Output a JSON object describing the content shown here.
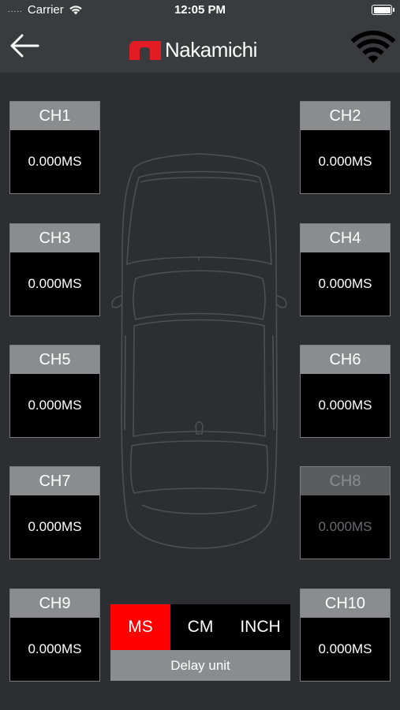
{
  "status_bar": {
    "signal_dots": ".....",
    "carrier": "Carrier",
    "time": "12:05 PM"
  },
  "header": {
    "brand": "Nakamichi",
    "back_icon": "back-arrow-icon",
    "wifi_icon": "wifi-icon"
  },
  "channels": [
    {
      "name": "CH1",
      "value": "0.000MS",
      "enabled": true
    },
    {
      "name": "CH2",
      "value": "0.000MS",
      "enabled": true
    },
    {
      "name": "CH3",
      "value": "0.000MS",
      "enabled": true
    },
    {
      "name": "CH4",
      "value": "0.000MS",
      "enabled": true
    },
    {
      "name": "CH5",
      "value": "0.000MS",
      "enabled": true
    },
    {
      "name": "CH6",
      "value": "0.000MS",
      "enabled": true
    },
    {
      "name": "CH7",
      "value": "0.000MS",
      "enabled": true
    },
    {
      "name": "CH8",
      "value": "0.000MS",
      "enabled": false
    },
    {
      "name": "CH9",
      "value": "0.000MS",
      "enabled": true
    },
    {
      "name": "CH10",
      "value": "0.000MS",
      "enabled": true
    }
  ],
  "delay_unit": {
    "options": [
      "MS",
      "CM",
      "INCH"
    ],
    "selected": "MS",
    "label": "Delay unit"
  },
  "colors": {
    "accent": "#ff0000",
    "background": "#2d2e31",
    "header_bar": "#3a3b3e",
    "channel_header": "#8b8c8e",
    "channel_value_bg": "#000000"
  }
}
